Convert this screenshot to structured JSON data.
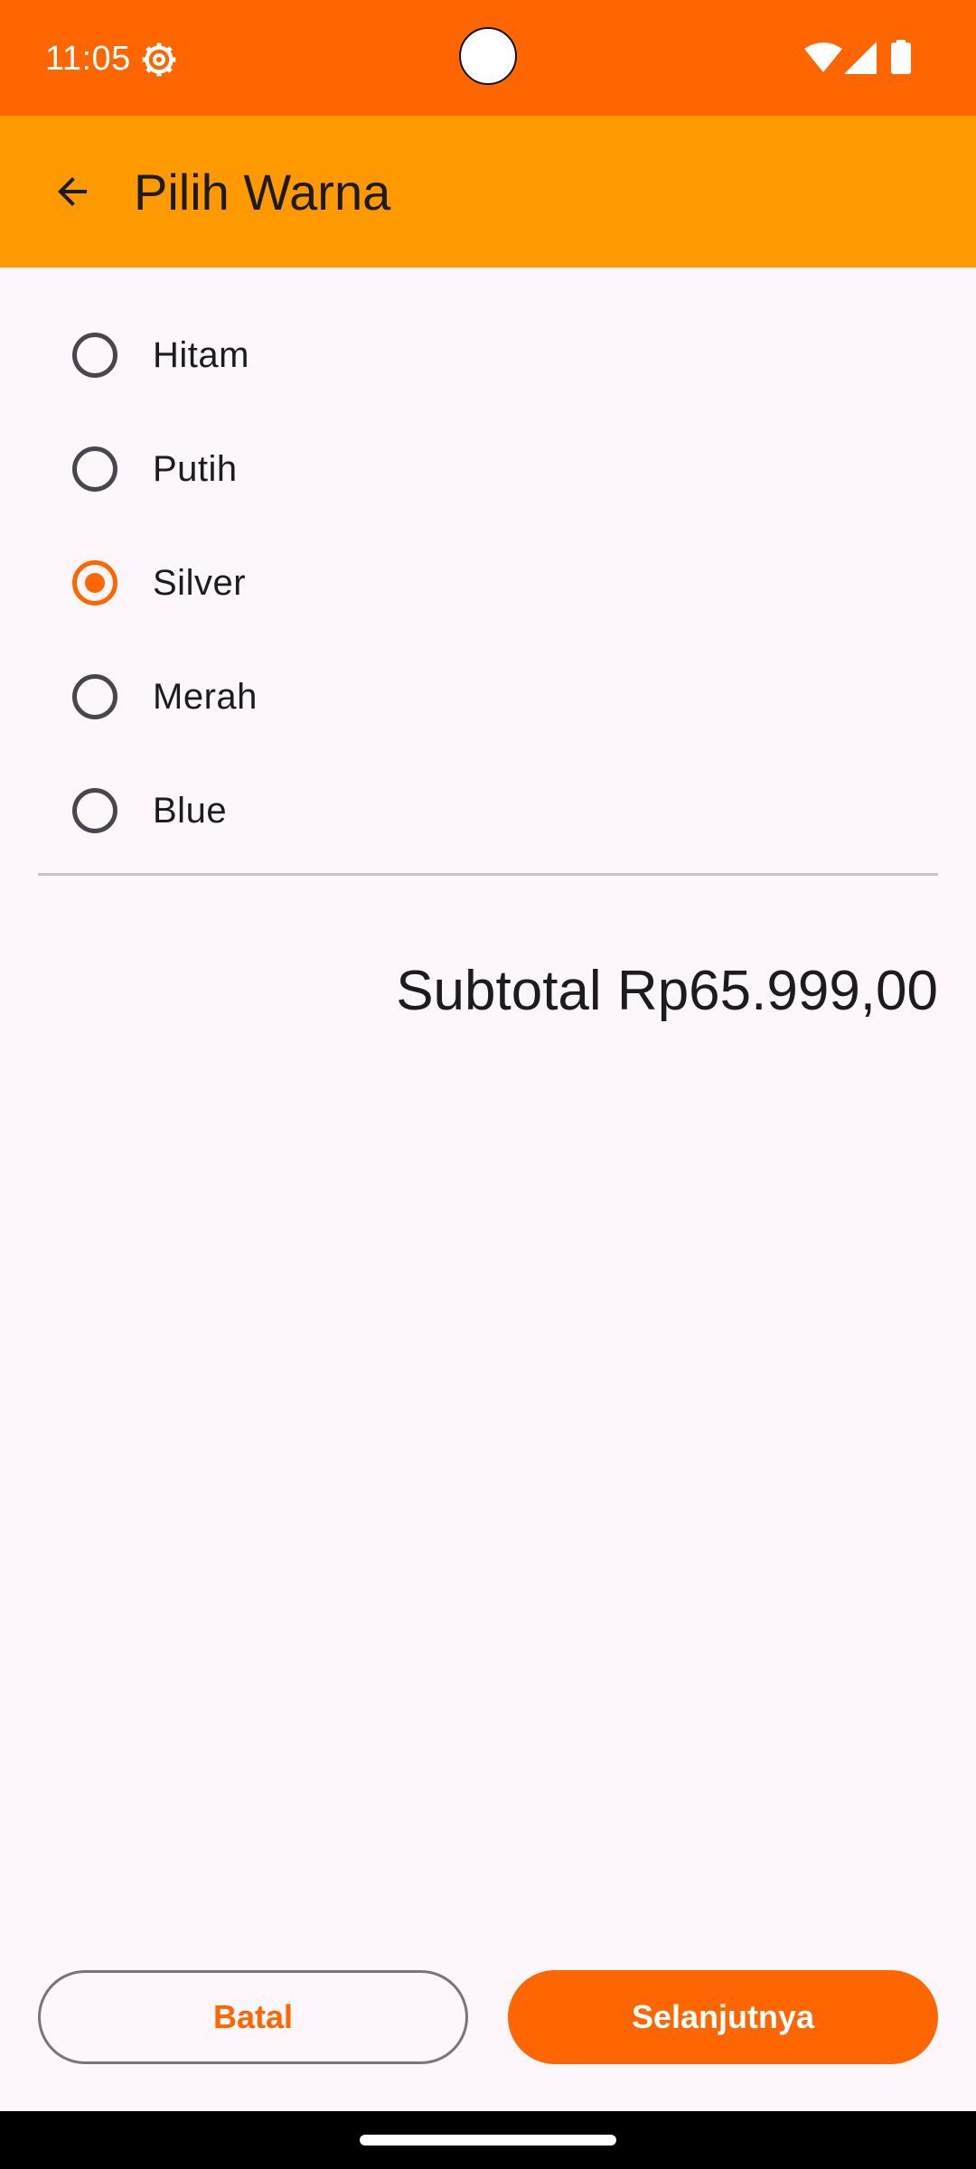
{
  "status_bar": {
    "time": "11:05",
    "icons": [
      "settings-icon",
      "wifi-icon",
      "signal-icon",
      "battery-icon"
    ],
    "background": "#ff6600"
  },
  "app_bar": {
    "title": "Pilih Warna",
    "back_icon": "arrow-back-icon",
    "background": "#ff9900"
  },
  "color_options": [
    {
      "label": "Hitam",
      "selected": false
    },
    {
      "label": "Putih",
      "selected": false
    },
    {
      "label": "Silver",
      "selected": true
    },
    {
      "label": "Merah",
      "selected": false
    },
    {
      "label": "Blue",
      "selected": false
    }
  ],
  "subtotal": "Subtotal Rp65.999,00",
  "buttons": {
    "cancel_label": "Batal",
    "next_label": "Selanjutnya"
  },
  "colors": {
    "accent": "#ff6600",
    "background": "#fdf7fb"
  }
}
